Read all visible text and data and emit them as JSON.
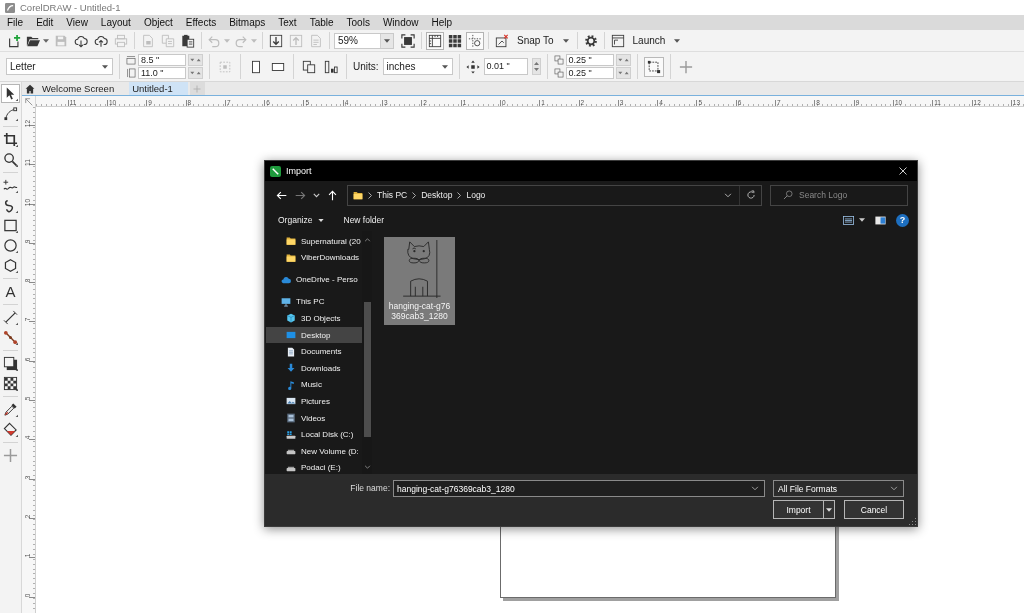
{
  "title_bar": {
    "title": "CorelDRAW - Untitled-1"
  },
  "menu": [
    "File",
    "Edit",
    "View",
    "Layout",
    "Object",
    "Effects",
    "Bitmaps",
    "Text",
    "Table",
    "Tools",
    "Window",
    "Help"
  ],
  "standard_toolbar": [
    [
      {
        "kind": "new",
        "disabled": false
      },
      {
        "kind": "open",
        "disabled": false,
        "dropdown": true
      },
      {
        "kind": "save",
        "disabled": true
      },
      {
        "kind": "cloud-download",
        "disabled": false
      },
      {
        "kind": "cloud-upload",
        "disabled": false
      },
      {
        "kind": "print",
        "disabled": true
      }
    ],
    [
      {
        "kind": "cut",
        "disabled": true
      },
      {
        "kind": "copy",
        "disabled": true
      },
      {
        "kind": "paste",
        "disabled": false
      }
    ],
    [
      {
        "kind": "undo",
        "disabled": true,
        "dropdown": true
      },
      {
        "kind": "redo",
        "disabled": true,
        "dropdown": true
      }
    ],
    [
      {
        "kind": "import",
        "disabled": false
      },
      {
        "kind": "export",
        "disabled": true
      },
      {
        "kind": "pdf",
        "disabled": true
      }
    ],
    [
      {
        "kind": "zoom",
        "value": "59%"
      },
      {
        "kind": "fit",
        "disabled": false
      }
    ],
    [
      {
        "kind": "rulers",
        "disabled": false,
        "on": true
      },
      {
        "kind": "grid",
        "disabled": false,
        "on": false
      },
      {
        "kind": "guidelines",
        "disabled": false,
        "on": true
      }
    ],
    [
      {
        "kind": "snap",
        "disabled": false
      },
      {
        "kind": "menu",
        "label": "Snap To"
      }
    ],
    [
      {
        "kind": "options",
        "disabled": false
      }
    ],
    [
      {
        "kind": "launch",
        "disabled": false
      },
      {
        "kind": "menu",
        "label": "Launch"
      }
    ]
  ],
  "property_bar": {
    "paper": "Letter",
    "width": "8.5 \"",
    "height": "11.0 \"",
    "page_frame_button": {
      "disabled": true
    },
    "units_label": "Units:",
    "units": "inches",
    "nudge": "0.01 \"",
    "duplicate_x": "0.25 \"",
    "duplicate_y": "0.25 \""
  },
  "document_tabs": [
    {
      "kind": "home",
      "label": "Welcome Screen",
      "selected": false
    },
    {
      "kind": "document",
      "label": "Untitled-1",
      "selected": true
    }
  ],
  "rulers": {
    "horizontal": [
      "11",
      "10",
      "9",
      "8",
      "7",
      "6",
      "5",
      "4",
      "3",
      "2",
      "1",
      "0",
      "1",
      "2",
      "3",
      "4",
      "5",
      "6",
      "7",
      "8",
      "9",
      "10",
      "11",
      "12",
      "13"
    ],
    "vertical": [
      "12",
      "11",
      "10",
      "9",
      "8",
      "7",
      "6",
      "5",
      "4",
      "3",
      "2",
      "1",
      "0"
    ]
  },
  "toolbox": [
    [
      {
        "kind": "pick",
        "selected": true
      },
      {
        "kind": "shape",
        "selected": false
      }
    ],
    [
      {
        "kind": "crop",
        "selected": false
      },
      {
        "kind": "zoom",
        "selected": false
      }
    ],
    [
      {
        "kind": "freehand",
        "selected": false
      },
      {
        "kind": "artistic",
        "selected": false
      },
      {
        "kind": "rectangle",
        "selected": false
      },
      {
        "kind": "ellipse",
        "selected": false
      },
      {
        "kind": "polygon",
        "selected": false
      }
    ],
    [
      {
        "kind": "text",
        "glyph": "A",
        "selected": false
      }
    ],
    [
      {
        "kind": "dimension",
        "selected": false
      },
      {
        "kind": "connector",
        "selected": false
      }
    ],
    [
      {
        "kind": "shadow",
        "selected": false
      },
      {
        "kind": "transparency",
        "selected": false
      }
    ],
    [
      {
        "kind": "eyedropper",
        "selected": false
      },
      {
        "kind": "fill",
        "selected": false
      }
    ]
  ],
  "import_dialog": {
    "title": "Import",
    "back_button": {
      "disabled": false
    },
    "forward_button": {
      "disabled": true
    },
    "address": [
      "This PC",
      "Desktop",
      "Logo"
    ],
    "search": {
      "placeholder": "Search Logo"
    },
    "organize": "Organize",
    "new_folder": "New folder",
    "help": "?",
    "nav_pane": {
      "pinned": [
        {
          "kind": "folder",
          "label": "Supernatural (20",
          "selected": false
        },
        {
          "kind": "folder",
          "label": "ViberDownloads",
          "selected": false
        }
      ],
      "tree": [
        {
          "kind": "cloud",
          "label": "OneDrive - Perso",
          "selected": false
        },
        {
          "kind": "pc",
          "label": "This PC",
          "selected": false,
          "children": [
            {
              "kind": "objects",
              "label": "3D Objects",
              "selected": false
            },
            {
              "kind": "desktop",
              "label": "Desktop",
              "selected": true
            },
            {
              "kind": "documents",
              "label": "Documents",
              "selected": false
            },
            {
              "kind": "downloads",
              "label": "Downloads",
              "selected": false
            },
            {
              "kind": "music",
              "label": "Music",
              "selected": false
            },
            {
              "kind": "pictures",
              "label": "Pictures",
              "selected": false
            },
            {
              "kind": "videos",
              "label": "Videos",
              "selected": false
            },
            {
              "kind": "system-drive",
              "label": "Local Disk (C:)",
              "selected": false
            },
            {
              "kind": "drive",
              "label": "New Volume (D:",
              "selected": false
            },
            {
              "kind": "drive",
              "label": "Podaci (E:)",
              "selected": false
            }
          ]
        }
      ]
    },
    "files": [
      {
        "name": "hanging-cat-g76\n369cab3_1280",
        "selected": true
      }
    ],
    "file_name_label": "File name:",
    "file_name": "hanging-cat-g76369cab3_1280",
    "file_type": "All File Formats",
    "import_button": "Import",
    "cancel_button": "Cancel"
  }
}
